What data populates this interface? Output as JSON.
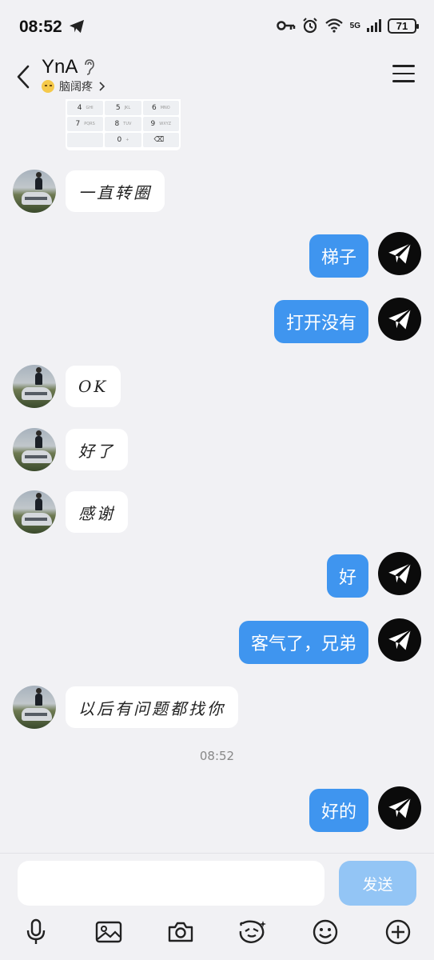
{
  "status": {
    "time": "08:52",
    "network": "5G",
    "battery": "71"
  },
  "header": {
    "title": "YnA",
    "subtitle": "脑阔疼"
  },
  "keypad": [
    {
      "d": "4",
      "l": "GHI"
    },
    {
      "d": "5",
      "l": "JKL"
    },
    {
      "d": "6",
      "l": "MNO"
    },
    {
      "d": "7",
      "l": "PQRS"
    },
    {
      "d": "8",
      "l": "TUV"
    },
    {
      "d": "9",
      "l": "WXYZ"
    },
    {
      "d": "",
      "l": ""
    },
    {
      "d": "0",
      "l": "+"
    },
    {
      "d": "⌫",
      "l": ""
    }
  ],
  "messages": [
    {
      "side": "in",
      "text": "一直转圈"
    },
    {
      "side": "out",
      "text": "梯子"
    },
    {
      "side": "out",
      "text": "打开没有"
    },
    {
      "side": "in",
      "text": "OK"
    },
    {
      "side": "in",
      "text": "好了"
    },
    {
      "side": "in",
      "text": "感谢"
    },
    {
      "side": "out",
      "text": "好"
    },
    {
      "side": "out",
      "text": "客气了，兄弟"
    },
    {
      "side": "in",
      "text": "以后有问题都找你"
    },
    {
      "side": "out",
      "text": "好的"
    }
  ],
  "timestamp": "08:52",
  "composer": {
    "input_value": "",
    "send_label": "发送"
  },
  "toolbar": [
    "mic-icon",
    "image-icon",
    "camera-icon",
    "sticker-icon",
    "emoji-icon",
    "plus-icon"
  ]
}
